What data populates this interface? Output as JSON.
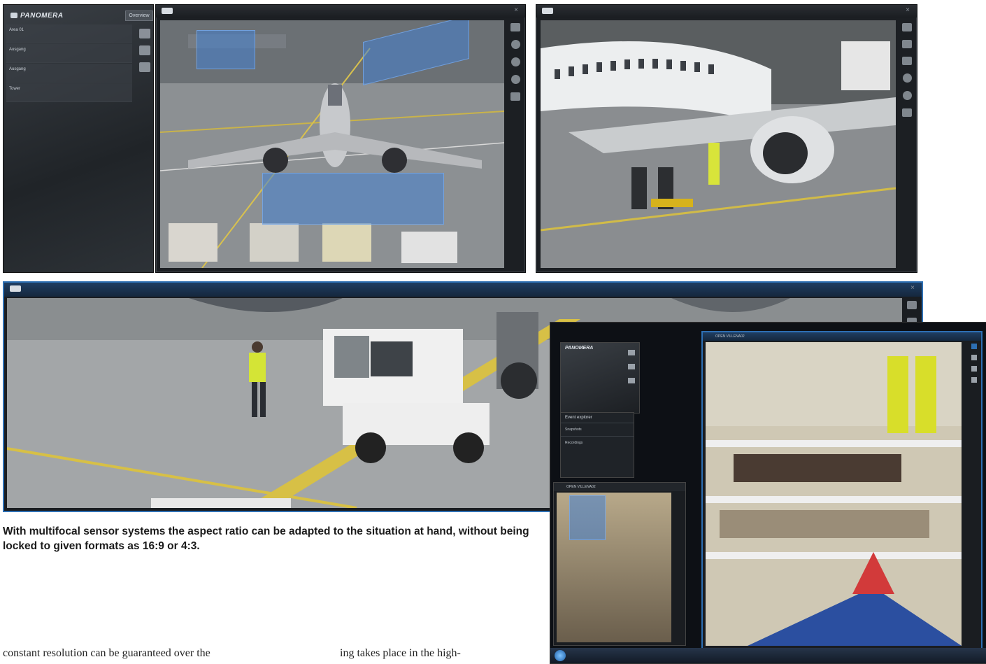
{
  "brand": "PANOMERA",
  "overview_label": "Overview",
  "left_panel": {
    "items": [
      "Area 01",
      "Ausgang",
      "Ausgang",
      "Tower"
    ]
  },
  "right_shot": {
    "brand": "PANOMERA",
    "panel_title": "Event explorer",
    "panel_items": [
      "Snapshots",
      "Recordings"
    ],
    "window_title": "OPEN VILLENA02"
  },
  "caption": "With multifocal sensor systems the aspect ratio can be adapted to the situation at hand, without being locked to given formats as 16:9 or 4:3.",
  "body_left": "constant resolution can be guaranteed over the",
  "body_right": "ing takes place in the high-",
  "colors": {
    "accent": "#2d6fb3",
    "selection": "#4682d2"
  }
}
